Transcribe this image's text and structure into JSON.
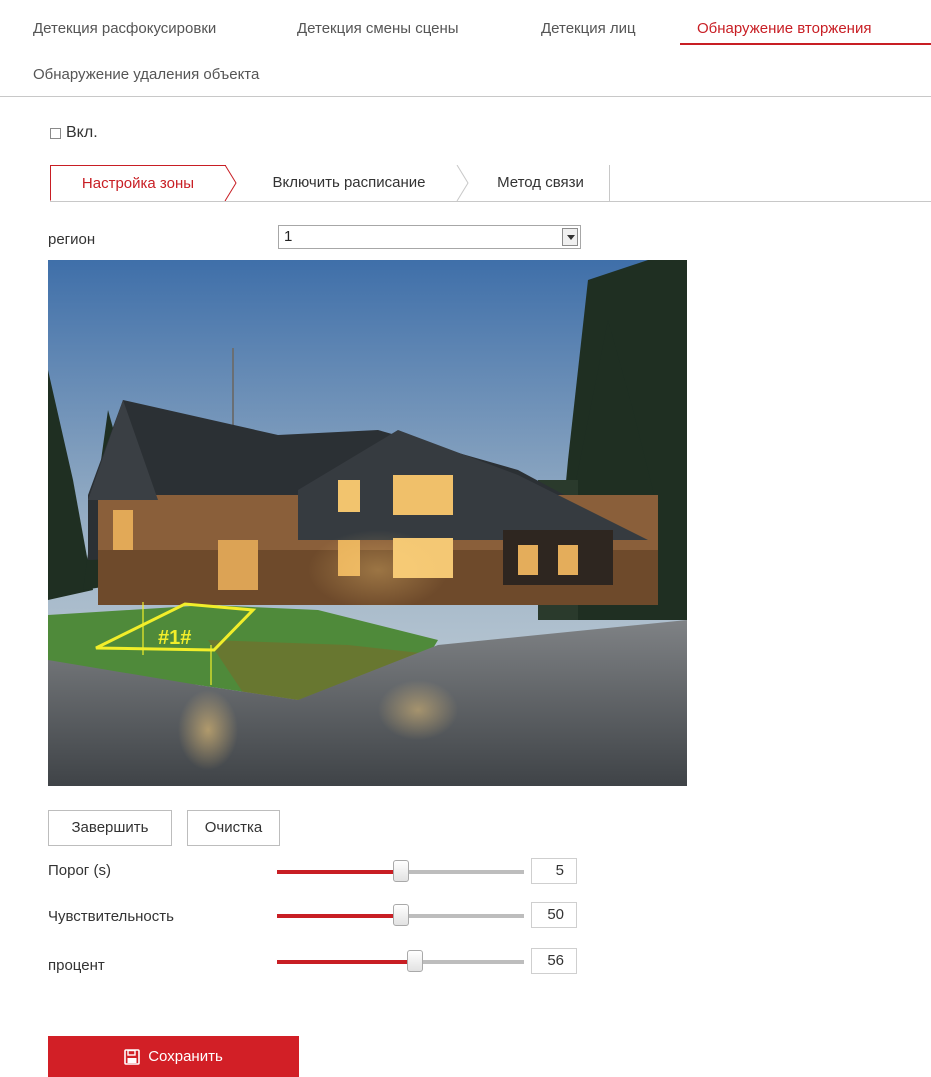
{
  "top_tabs": [
    {
      "label": "Детекция расфокусировки",
      "active": false
    },
    {
      "label": "Детекция смены сцены",
      "active": false
    },
    {
      "label": "Детекция лиц",
      "active": false
    },
    {
      "label": "Обнаружение вторжения",
      "active": true
    },
    {
      "label": "Обнаружение удаления объекта",
      "active": false
    }
  ],
  "enable": {
    "label": "Вкл.",
    "checked": false
  },
  "sub_tabs": [
    {
      "label": "Настройка зоны",
      "active": true
    },
    {
      "label": "Включить расписание",
      "active": false
    },
    {
      "label": "Метод связи",
      "active": false
    }
  ],
  "region": {
    "label": "регион",
    "value": "1"
  },
  "video": {
    "zone_label": "#1#",
    "zone_color": "#f2ee2a"
  },
  "buttons": {
    "finish": "Завершить",
    "clear": "Очистка"
  },
  "sliders": [
    {
      "label": "Порог (s)",
      "value": "5",
      "fraction": 0.5
    },
    {
      "label": "Чувствительность",
      "value": "50",
      "fraction": 0.5
    },
    {
      "label": "процент",
      "value": "56",
      "fraction": 0.56
    }
  ],
  "save_label": "Сохранить",
  "colors": {
    "accent": "#c81e24",
    "save_bg": "#d21f26"
  }
}
